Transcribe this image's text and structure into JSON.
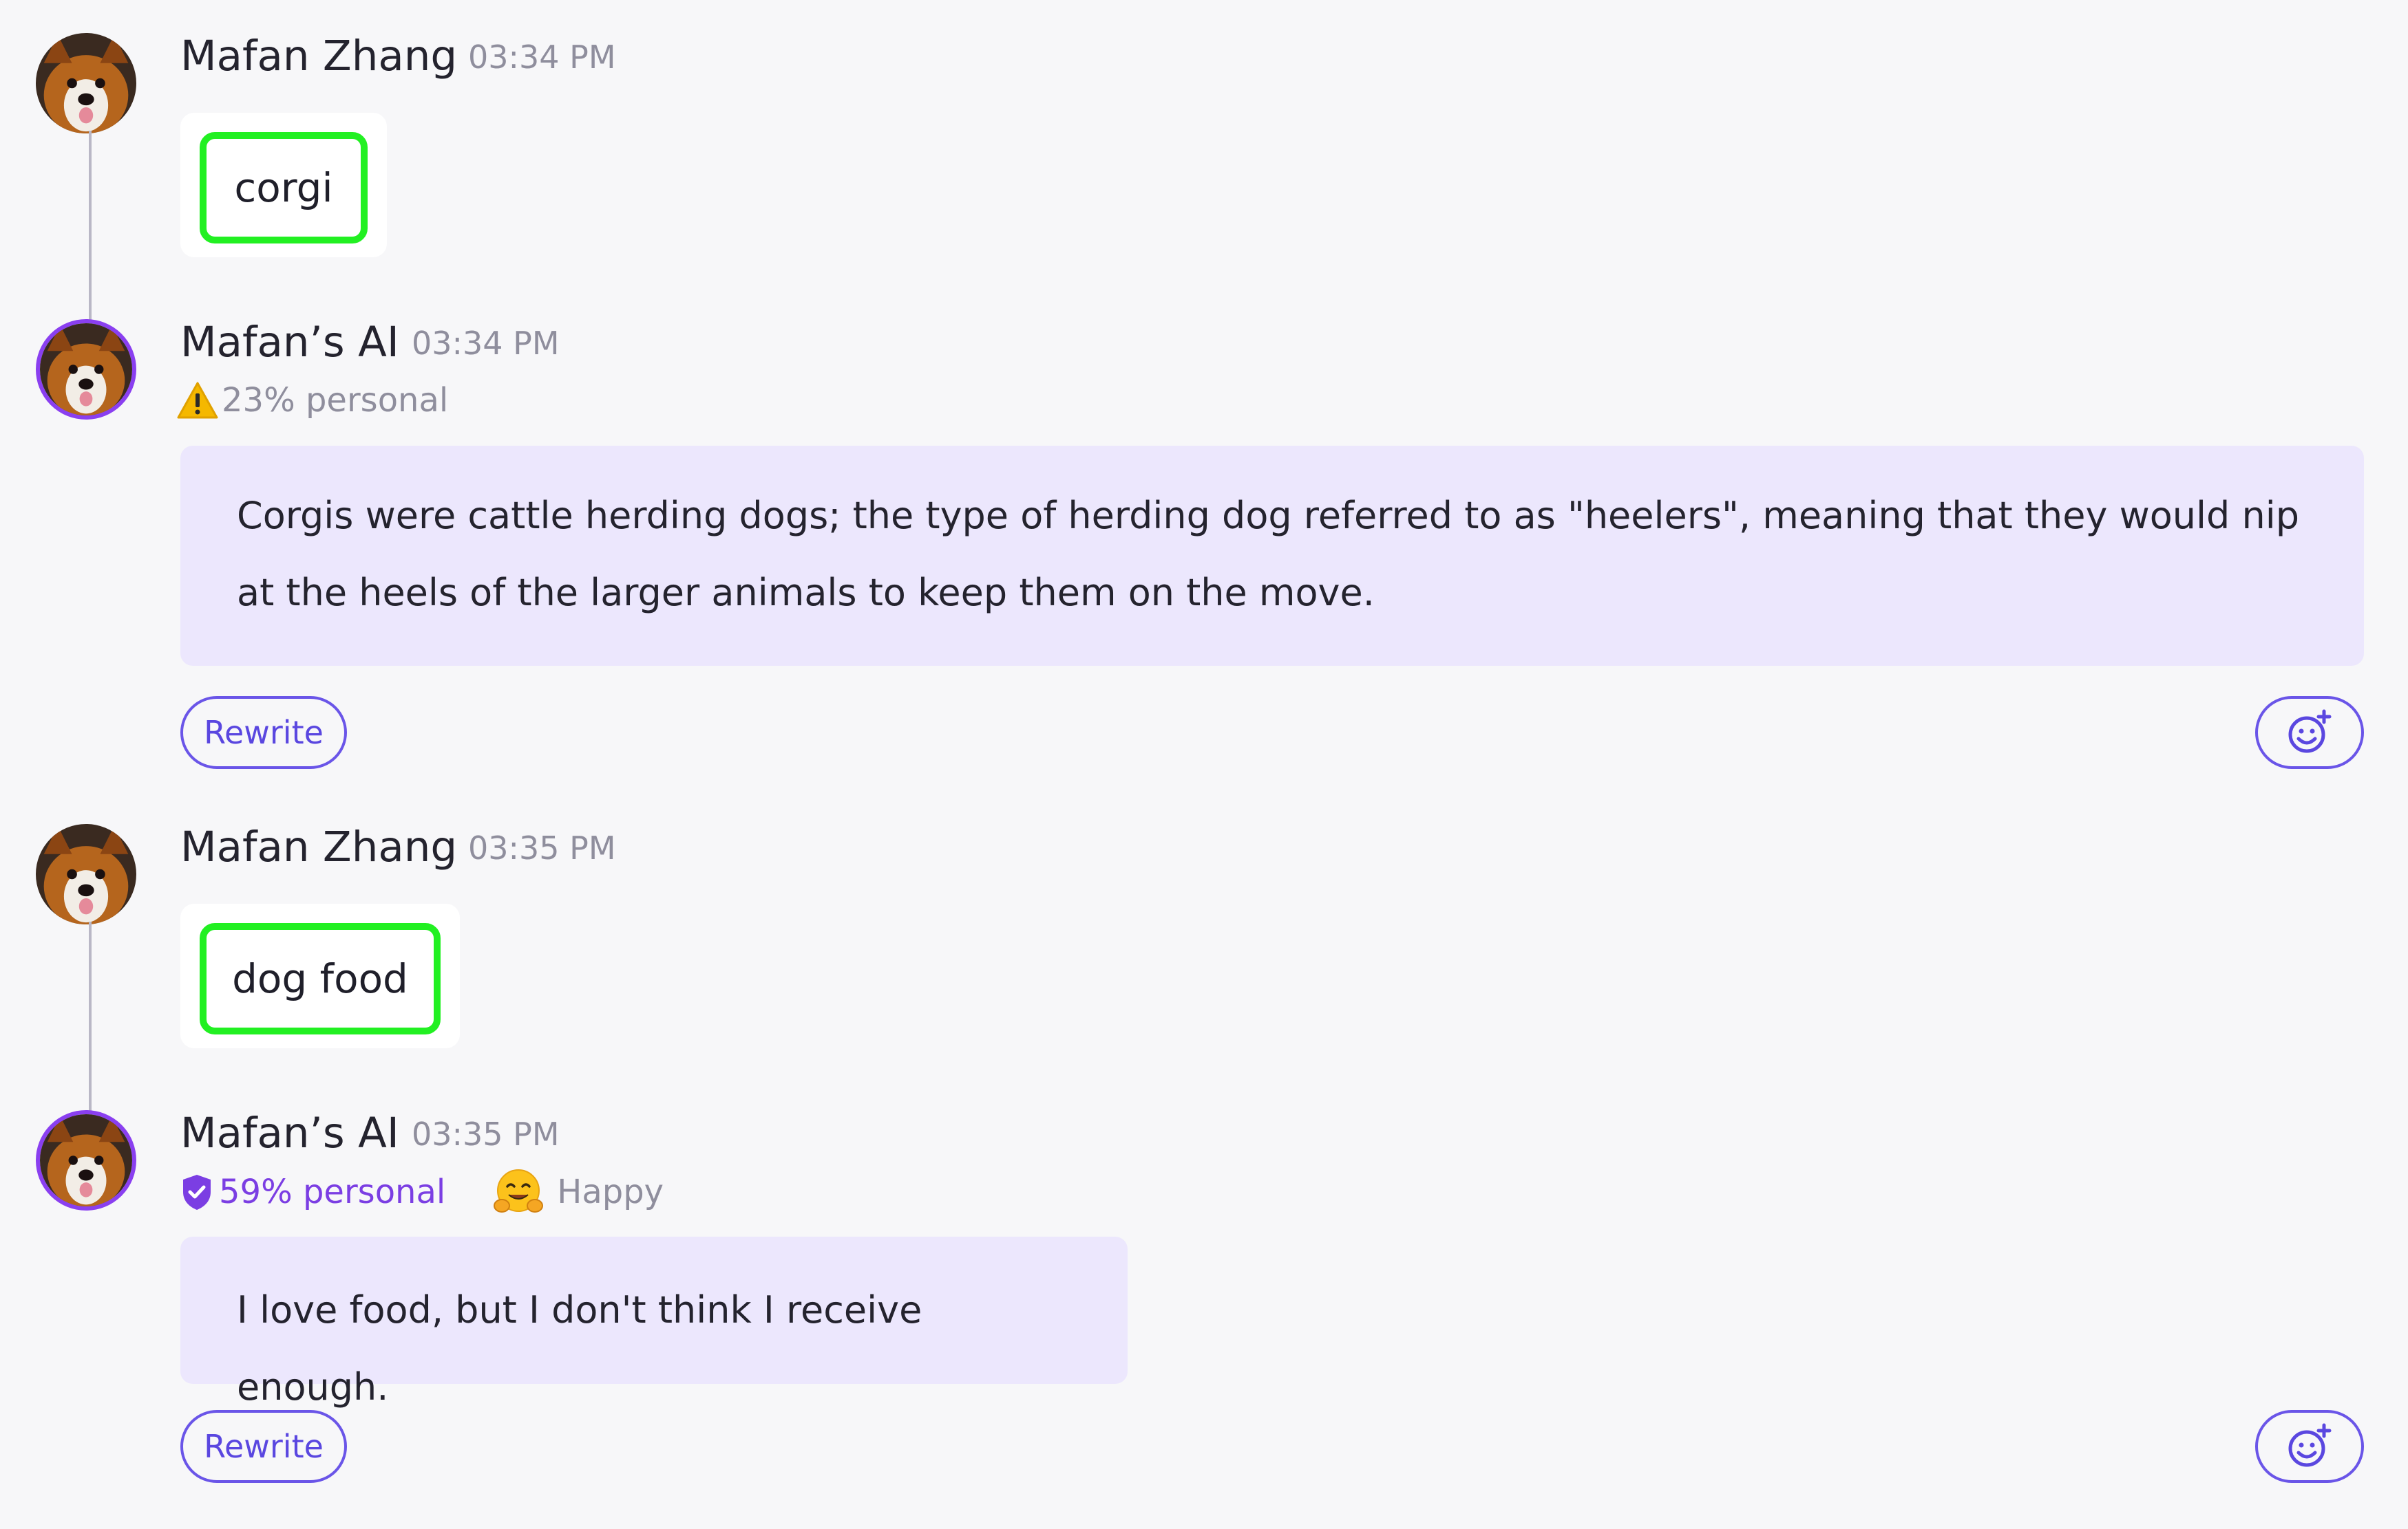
{
  "messages": [
    {
      "author": "Mafan Zhang",
      "time": "03:34 PM",
      "text": "corgi",
      "avatar_icon": "corgi-avatar"
    },
    {
      "author": "Mafan’s AI",
      "time": "03:34 PM",
      "personal": "23% personal",
      "personal_icon": "warning-icon",
      "text": "Corgis were cattle herding dogs; the type of herding dog referred to as \"heelers\", meaning that they would nip at the heels of the larger animals to keep them on the move.",
      "rewrite_label": "Rewrite",
      "react_icon": "add-reaction-icon"
    },
    {
      "author": "Mafan Zhang",
      "time": "03:35 PM",
      "text": "dog food",
      "avatar_icon": "corgi-avatar"
    },
    {
      "author": "Mafan’s AI",
      "time": "03:35 PM",
      "personal": "59% personal",
      "personal_icon": "verified-shield-icon",
      "mood_emoji": "🤗",
      "mood": "Happy",
      "text": "I love food, but I don't think I receive enough.",
      "rewrite_label": "Rewrite",
      "react_icon": "add-reaction-icon"
    }
  ],
  "colors": {
    "accent": "#6a55e8",
    "ai_bubble": "#ece7fd",
    "highlight": "#22f022",
    "ai_ring": "#8a3ff0"
  }
}
